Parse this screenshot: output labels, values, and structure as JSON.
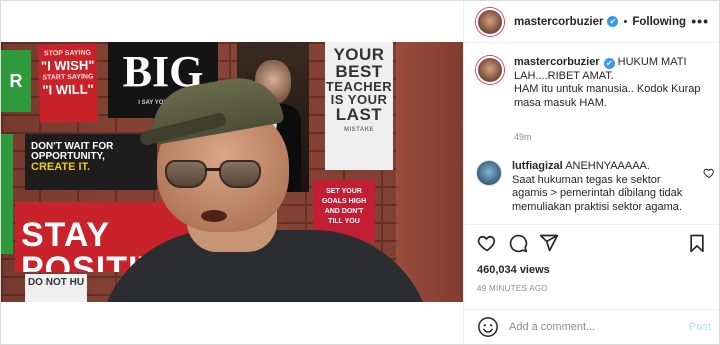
{
  "post": {
    "username": "mastercorbuzier",
    "follow_state": "Following",
    "more_label": "•••",
    "verified_glyph": "✔"
  },
  "media": {
    "posters": {
      "green_left": "R",
      "wish_line1": "STOP SAYING",
      "wish_line2": "\"I WISH\"",
      "wish_line3": "START SAYING",
      "wish_line4": "\"I WILL\"",
      "big_text": "BIG",
      "big_sub": "I SAY YOU THINK",
      "teacher_line1": "YOUR",
      "teacher_line2": "BEST",
      "teacher_line3": "TEACHER",
      "teacher_line4": "IS YOUR",
      "teacher_line5": "LAST",
      "teacher_line6": "MISTAKE",
      "goals_line1": "SET YOUR",
      "goals_line2": "GOALS HIGH",
      "goals_line3": "AND DON'T",
      "goals_line4": "TILL YOU",
      "dont_line1": "DON'T WAIT FOR",
      "dont_line2": "OPPORTUNITY,",
      "dont_line3": "CREATE IT.",
      "stay_text": "STAY POSITIVE",
      "notdo_text": "DO NOT HU"
    }
  },
  "caption": {
    "username": "mastercorbuzier",
    "text_line1": "HUKUM MATI",
    "text_line2": "LAH....RIBET AMAT.",
    "text_line3": "HAM itu untuk manusia.. Kodok Kurap",
    "text_line4": "masa masuk HAM.",
    "time": "49m"
  },
  "comments": [
    {
      "username": "lutfiagizal",
      "text_line1": "ANEHNYAAAAA.",
      "text_line2": "Saat hukuman tegas ke sektor",
      "text_line3": "agamis > pemerintah dibilang tidak",
      "text_line4": "memuliakan praktisi sektor agama."
    }
  ],
  "stats": {
    "likes": "460,034 views",
    "posted": "49 MINUTES AGO"
  },
  "composer": {
    "placeholder": "Add a comment...",
    "post_label": "Post"
  },
  "icons": {
    "like": "heart-icon",
    "comment": "comment-icon",
    "share": "share-icon",
    "save": "bookmark-icon",
    "emoji": "emoji-icon",
    "comment_like": "heart-icon"
  },
  "colors": {
    "verified": "#3897f0",
    "post_button": "#b2dffc",
    "muted": "#8e8e8e",
    "text": "#262626"
  }
}
